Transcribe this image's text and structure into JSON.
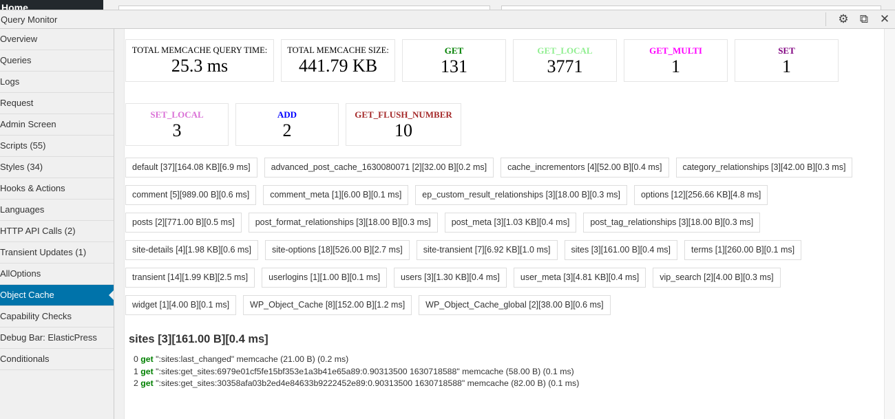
{
  "wp": {
    "menu_label": "Home"
  },
  "panel": {
    "title": "Query Monitor",
    "icons": [
      "gear-icon",
      "popout-icon",
      "close-icon"
    ]
  },
  "nav": [
    {
      "label": "Overview"
    },
    {
      "label": "Queries"
    },
    {
      "label": "Logs"
    },
    {
      "label": "Request"
    },
    {
      "label": "Admin Screen"
    },
    {
      "label": "Scripts (55)"
    },
    {
      "label": "Styles (34)"
    },
    {
      "label": "Hooks & Actions"
    },
    {
      "label": "Languages"
    },
    {
      "label": "HTTP API Calls (2)"
    },
    {
      "label": "Transient Updates (1)"
    },
    {
      "label": "AllOptions"
    },
    {
      "label": "Object Cache",
      "active": true
    },
    {
      "label": "Capability Checks"
    },
    {
      "label": "Debug Bar: ElasticPress"
    },
    {
      "label": "Conditionals"
    }
  ],
  "stats_row1": [
    {
      "label": "Total Memcache Query Time:",
      "value": "25.3 ms",
      "color": "#000000"
    },
    {
      "label": "Total Memcache Size:",
      "value": "441.79 KB",
      "color": "#000000"
    },
    {
      "label": "GET",
      "value": "131",
      "color": "#008000"
    },
    {
      "label": "GET_LOCAL",
      "value": "3771",
      "color": "#90ee90"
    },
    {
      "label": "GET_MULTI",
      "value": "1",
      "color": "#ff00ff"
    },
    {
      "label": "SET",
      "value": "1",
      "color": "#800080"
    }
  ],
  "stats_row2": [
    {
      "label": "SET_LOCAL",
      "value": "3",
      "color": "#da70d6"
    },
    {
      "label": "ADD",
      "value": "2",
      "color": "#0000ff"
    },
    {
      "label": "GET_FLUSH_NUMBER",
      "value": "10",
      "color": "#a52a2a"
    }
  ],
  "groups": [
    "default [37][164.08 KB][6.9 ms]",
    "advanced_post_cache_1630080071 [2][32.00 B][0.2 ms]",
    "cache_incrementors [4][52.00 B][0.4 ms]",
    "category_relationships [3][42.00 B][0.3 ms]",
    "comment [5][989.00 B][0.6 ms]",
    "comment_meta [1][6.00 B][0.1 ms]",
    "ep_custom_result_relationships [3][18.00 B][0.3 ms]",
    "options [12][256.66 KB][4.8 ms]",
    "posts [2][771.00 B][0.5 ms]",
    "post_format_relationships [3][18.00 B][0.3 ms]",
    "post_meta [3][1.03 KB][0.4 ms]",
    "post_tag_relationships [3][18.00 B][0.3 ms]",
    "site-details [4][1.98 KB][0.6 ms]",
    "site-options [18][526.00 B][2.7 ms]",
    "site-transient [7][6.92 KB][1.0 ms]",
    "sites [3][161.00 B][0.4 ms]",
    "terms [1][260.00 B][0.1 ms]",
    "transient [14][1.99 KB][2.5 ms]",
    "userlogins [1][1.00 B][0.1 ms]",
    "users [3][1.30 KB][0.4 ms]",
    "user_meta [3][4.81 KB][0.4 ms]",
    "vip_search [2][4.00 B][0.3 ms]",
    "widget [1][4.00 B][0.1 ms]",
    "WP_Object_Cache [8][152.00 B][1.2 ms]",
    "WP_Object_Cache_global [2][38.00 B][0.6 ms]"
  ],
  "detail": {
    "title": "sites [3][161.00 B][0.4 ms]",
    "lines": [
      {
        "index": "0",
        "op": "get",
        "text": "\":sites:last_changed\" memcache (21.00 B) (0.2 ms)"
      },
      {
        "index": "1",
        "op": "get",
        "text": "\":sites:get_sites:6979e01cf5fe15bf353e1a3b41e65a89:0.90313500 1630718588\" memcache (58.00 B) (0.1 ms)"
      },
      {
        "index": "2",
        "op": "get",
        "text": "\":sites:get_sites:30358afa03b2ed4e84633b9222452e89:0.90313500 1630718588\" memcache (82.00 B) (0.1 ms)"
      }
    ]
  }
}
